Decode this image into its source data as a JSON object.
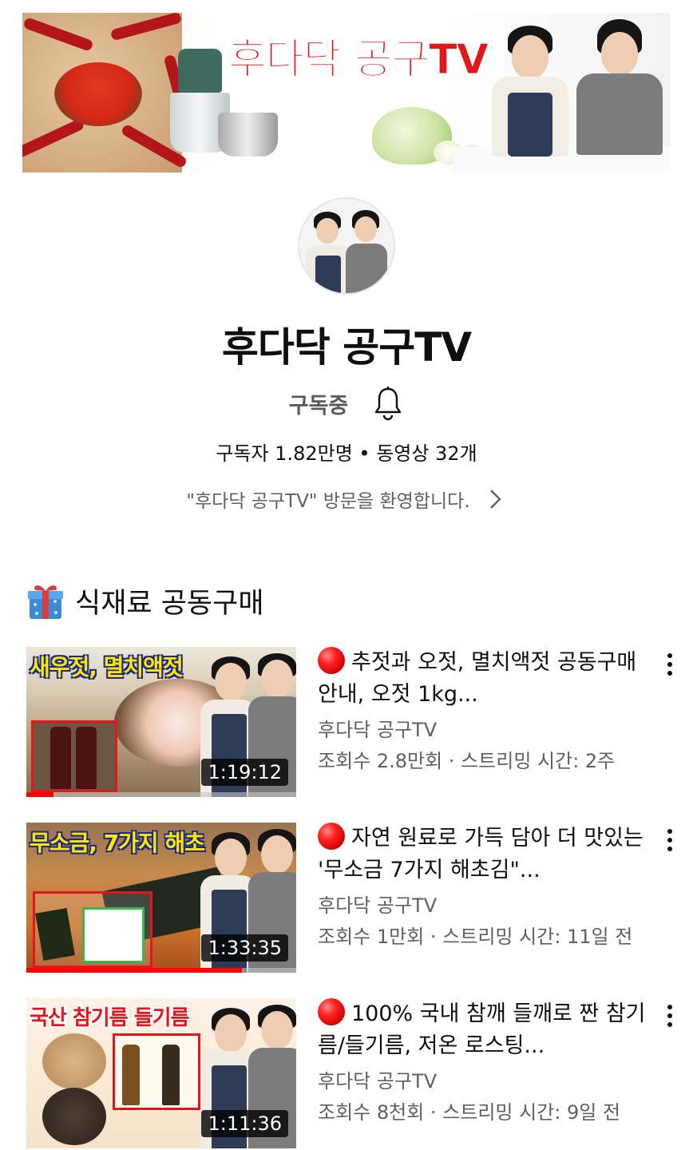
{
  "banner": {
    "title": "후다닥 공구TV"
  },
  "channel": {
    "name": "후다닥 공구TV",
    "subscribe_label": "구독중",
    "stats": "구독자 1.82만명 • 동영상 32개",
    "description": "\"후다닥 공구TV\"  방문을 환영합니다."
  },
  "section": {
    "title": "식재료 공동구매",
    "icon": "gift-icon"
  },
  "videos": [
    {
      "thumb_caption": "새우젓, 멸치액젓",
      "duration": "1:19:12",
      "progress": 0.1,
      "title": "추젓과 오젓, 멸치액젓 공동구매 안내, 오젓 1kg...",
      "channel": "후다닥 공구TV",
      "stats": "조회수 2.8만회 · 스트리밍 시간: 2주"
    },
    {
      "thumb_caption": "무소금, 7가지 해초",
      "duration": "1:33:35",
      "progress": 0.8,
      "title": "자연 원료로 가득 담아 더 맛있는  '무소금 7가지 해초김\"...",
      "channel": "후다닥 공구TV",
      "stats": "조회수 1만회 · 스트리밍 시간: 11일 전"
    },
    {
      "thumb_caption": "국산 참기름 들기름",
      "duration": "1:11:36",
      "progress": 0,
      "title": "100% 국내 참깨 들깨로 짠 참기름/들기름, 저온 로스팅...",
      "channel": "후다닥 공구TV",
      "stats": "조회수 8천회 · 스트리밍 시간: 9일 전"
    }
  ],
  "colors": {
    "accent_red": "#ff0000",
    "banner_title": "#e3171b",
    "caption_yellow": "#ffe600",
    "caption_red": "#e3171b"
  }
}
